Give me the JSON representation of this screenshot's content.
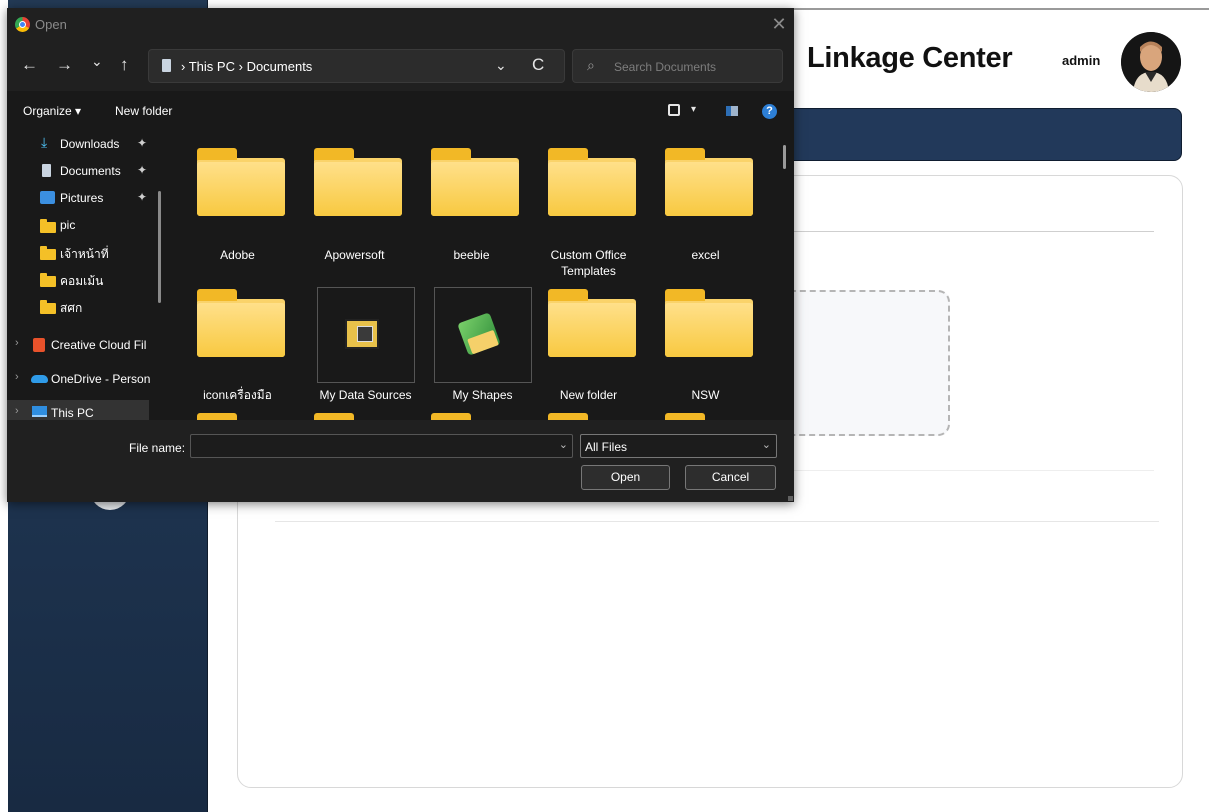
{
  "web": {
    "title": "Linkage Center",
    "user": "admin"
  },
  "dialog": {
    "title": "Open",
    "close_glyph": "✕",
    "nav": {
      "back": "←",
      "forward": "→",
      "recent": "⌄",
      "up": "↑",
      "refresh": "C"
    },
    "breadcrumb": [
      "This PC",
      "Documents"
    ],
    "breadcrumb_sep": "›",
    "search_placeholder": "Search Documents",
    "toolbar": {
      "organize": "Organize ▾",
      "new_folder": "New folder",
      "help": "?"
    },
    "nav_items": [
      {
        "label": "Downloads",
        "icon": "download-icon",
        "pinned": true
      },
      {
        "label": "Documents",
        "icon": "document-icon",
        "pinned": true
      },
      {
        "label": "Pictures",
        "icon": "pictures-icon",
        "pinned": true
      },
      {
        "label": "pic",
        "icon": "folder-icon"
      },
      {
        "label": "เจ้าหน้าที่",
        "icon": "folder-icon"
      },
      {
        "label": "คอมเม้น",
        "icon": "folder-icon"
      },
      {
        "label": "สศก",
        "icon": "folder-icon"
      },
      {
        "label": "Creative Cloud Fil",
        "icon": "creative-cloud-icon",
        "expandable": true
      },
      {
        "label": "OneDrive - Person",
        "icon": "onedrive-icon",
        "expandable": true
      },
      {
        "label": "This PC",
        "icon": "this-pc-icon",
        "expandable": true,
        "selected": true
      }
    ],
    "pin_glyph": "📌",
    "files": [
      {
        "name": "Adobe",
        "type": "folder"
      },
      {
        "name": "Apowersoft",
        "type": "folder"
      },
      {
        "name": "beebie",
        "type": "folder"
      },
      {
        "name": "Custom Office Templates",
        "type": "folder"
      },
      {
        "name": "excel",
        "type": "folder"
      },
      {
        "name": "iconเครื่องมือ",
        "type": "folder"
      },
      {
        "name": "My Data Sources",
        "type": "special"
      },
      {
        "name": "My Shapes",
        "type": "special"
      },
      {
        "name": "New folder",
        "type": "folder"
      },
      {
        "name": "NSW",
        "type": "folder"
      }
    ],
    "file_name_label": "File name:",
    "file_name_value": "",
    "file_type": "All Files",
    "open_button": "Open",
    "cancel_button": "Cancel"
  }
}
